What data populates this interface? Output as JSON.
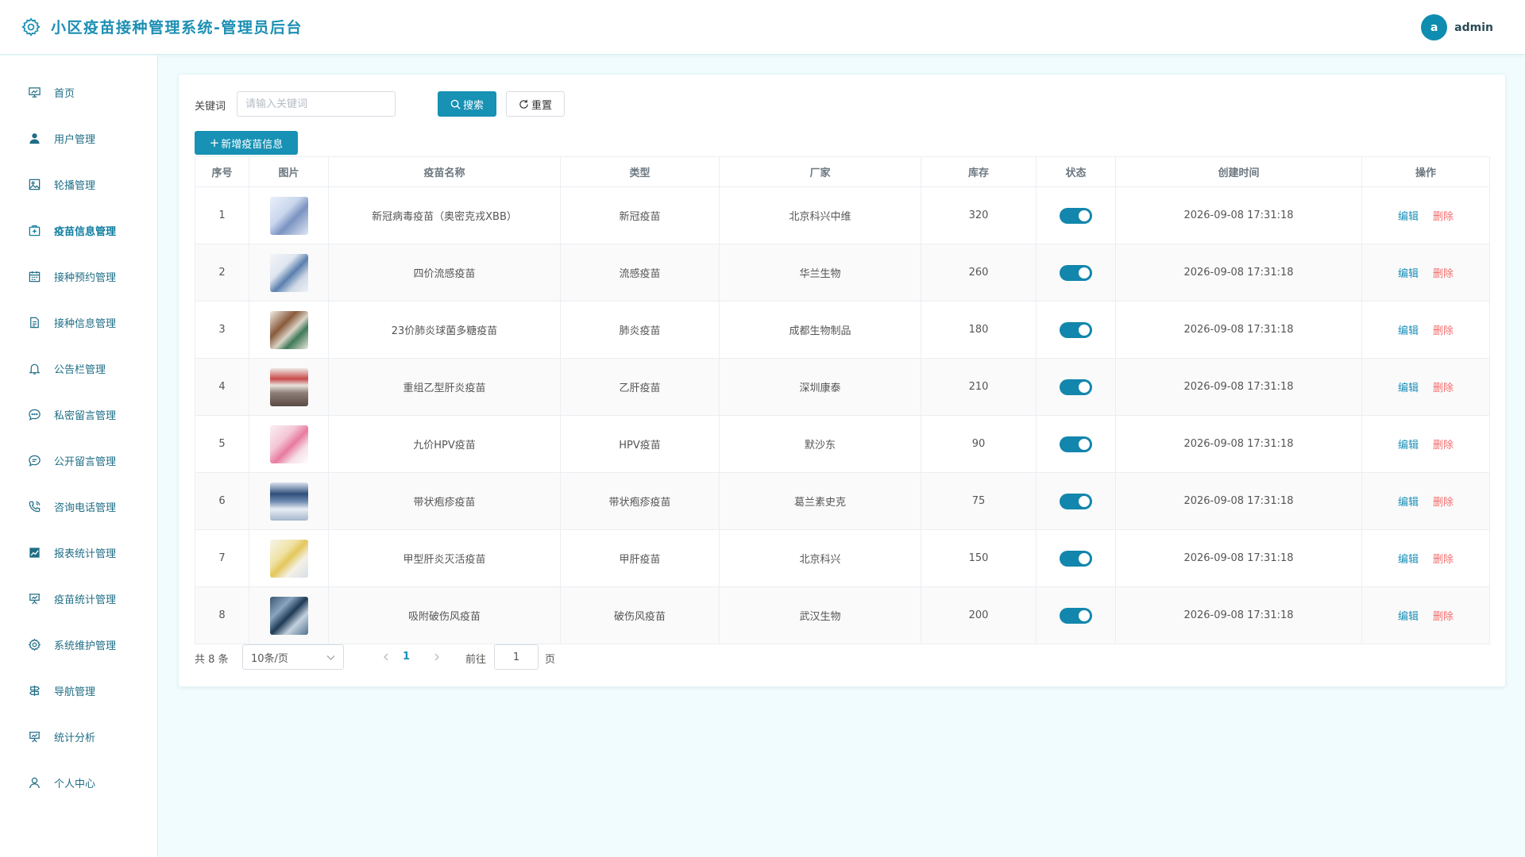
{
  "header": {
    "title": "小区疫苗接种管理系统-管理员后台",
    "avatar_letter": "a",
    "username": "admin"
  },
  "colors": {
    "primary": "#1791b4",
    "title": "#1c8fb3",
    "danger": "#f56c6c",
    "background": "#f0fcfd"
  },
  "sidebar": {
    "items": [
      {
        "label": "首页",
        "icon": "chart-board-icon"
      },
      {
        "label": "用户管理",
        "icon": "user-icon"
      },
      {
        "label": "轮播管理",
        "icon": "image-icon"
      },
      {
        "label": "疫苗信息管理",
        "icon": "medical-kit-icon",
        "active": true
      },
      {
        "label": "接种预约管理",
        "icon": "calendar-icon"
      },
      {
        "label": "接种信息管理",
        "icon": "document-icon"
      },
      {
        "label": "公告栏管理",
        "icon": "bell-icon"
      },
      {
        "label": "私密留言管理",
        "icon": "chat-bubble-icon"
      },
      {
        "label": "公开留言管理",
        "icon": "chat-lines-icon"
      },
      {
        "label": "咨询电话管理",
        "icon": "phone-icon"
      },
      {
        "label": "报表统计管理",
        "icon": "trend-chart-icon"
      },
      {
        "label": "疫苗统计管理",
        "icon": "presentation-icon"
      },
      {
        "label": "系统维护管理",
        "icon": "gear-icon"
      },
      {
        "label": "导航管理",
        "icon": "navigation-icon"
      },
      {
        "label": "统计分析",
        "icon": "presentation-icon"
      },
      {
        "label": "个人中心",
        "icon": "person-icon"
      }
    ]
  },
  "search": {
    "label": "关键词",
    "placeholder": "请输入关键词",
    "value": "",
    "search_label": "搜索",
    "reset_label": "重置"
  },
  "toolbar": {
    "add_label": "新增疫苗信息"
  },
  "table": {
    "columns": [
      "序号",
      "图片",
      "疫苗名称",
      "类型",
      "厂家",
      "库存",
      "状态",
      "创建时间",
      "操作"
    ],
    "edit_label": "编辑",
    "delete_label": "删除",
    "rows": [
      {
        "index": "1",
        "name": "新冠病毒疫苗（奥密克戎XBB）",
        "type": "新冠疫苗",
        "maker": "北京科兴中维",
        "stock": "320",
        "status_on": true,
        "created": "2026-09-08 17:31:18"
      },
      {
        "index": "2",
        "name": "四价流感疫苗",
        "type": "流感疫苗",
        "maker": "华兰生物",
        "stock": "260",
        "status_on": true,
        "created": "2026-09-08 17:31:18"
      },
      {
        "index": "3",
        "name": "23价肺炎球菌多糖疫苗",
        "type": "肺炎疫苗",
        "maker": "成都生物制品",
        "stock": "180",
        "status_on": true,
        "created": "2026-09-08 17:31:18"
      },
      {
        "index": "4",
        "name": "重组乙型肝炎疫苗",
        "type": "乙肝疫苗",
        "maker": "深圳康泰",
        "stock": "210",
        "status_on": true,
        "created": "2026-09-08 17:31:18"
      },
      {
        "index": "5",
        "name": "九价HPV疫苗",
        "type": "HPV疫苗",
        "maker": "默沙东",
        "stock": "90",
        "status_on": true,
        "created": "2026-09-08 17:31:18"
      },
      {
        "index": "6",
        "name": "带状疱疹疫苗",
        "type": "带状疱疹疫苗",
        "maker": "葛兰素史克",
        "stock": "75",
        "status_on": true,
        "created": "2026-09-08 17:31:18"
      },
      {
        "index": "7",
        "name": "甲型肝炎灭活疫苗",
        "type": "甲肝疫苗",
        "maker": "北京科兴",
        "stock": "150",
        "status_on": true,
        "created": "2026-09-08 17:31:18"
      },
      {
        "index": "8",
        "name": "吸附破伤风疫苗",
        "type": "破伤风疫苗",
        "maker": "武汉生物",
        "stock": "200",
        "status_on": true,
        "created": "2026-09-08 17:31:18"
      }
    ]
  },
  "pagination": {
    "total": "共 8 条",
    "page_size": "10条/页",
    "current_page": "1",
    "goto_label": "前往",
    "goto_value": "1",
    "page_suffix": "页"
  }
}
